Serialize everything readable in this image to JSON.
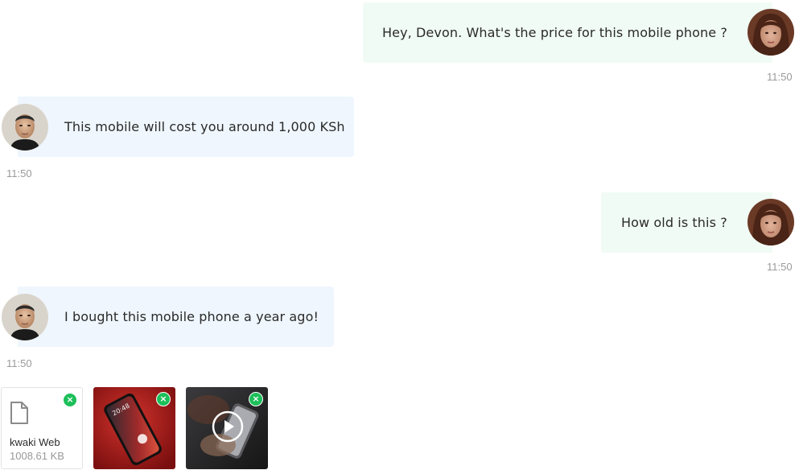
{
  "messages": [
    {
      "direction": "outgoing",
      "text": "Hey, Devon. What's the price for this mobile phone ?",
      "time": "11:50"
    },
    {
      "direction": "incoming",
      "text": "This mobile will cost you around 1,000 KSh",
      "time": "11:50"
    },
    {
      "direction": "outgoing",
      "text": "How old is this ?",
      "time": "11:50"
    },
    {
      "direction": "incoming",
      "text": "I bought this mobile phone a year ago!",
      "time": "11:50"
    }
  ],
  "attachments": [
    {
      "type": "file",
      "icon": "file-icon",
      "name": "kwaki Web",
      "size": "1008.61 KB",
      "remove_glyph": "×"
    },
    {
      "type": "image",
      "remove_glyph": "×",
      "phone_time": "20:48"
    },
    {
      "type": "video",
      "icon": "play-icon",
      "remove_glyph": "×"
    }
  ],
  "colors": {
    "outgoing_bubble": "#f1fbf5",
    "incoming_bubble": "#eff6fd",
    "remove_badge": "#1dbf5a",
    "timestamp": "#9a9a9a"
  }
}
